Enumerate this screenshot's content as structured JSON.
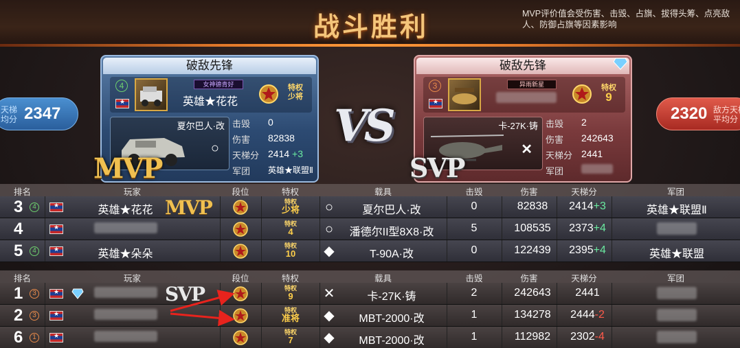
{
  "title": "战斗胜利",
  "mvp_note": "MVP评价值会受伤害、击毁、占旗、拔得头筹、点亮敌人、防御占旗等因素影响",
  "left_ladder": {
    "label": "天梯均分",
    "value": "2347"
  },
  "right_ladder": {
    "label": "敌方天梯平均分",
    "value": "2320"
  },
  "vs_text": "VS",
  "blue_card": {
    "header": "破敌先锋",
    "level": "4",
    "name_plate": "女神德青好",
    "player": "英雄★花花",
    "priv_top": "特权",
    "priv_bottom": "少将",
    "vehicle": "夏尔巴人·改",
    "vehicle_mark": "○",
    "badge": "MVP",
    "stats": {
      "kills_label": "击毁",
      "kills": "0",
      "damage_label": "伤害",
      "damage": "82838",
      "ladder_label": "天梯分",
      "ladder": "2414",
      "ladder_delta": "+3",
      "corps_label": "军团",
      "corps": "英雄★联盟Ⅱ"
    }
  },
  "red_card": {
    "header": "破敌先锋",
    "level": "3",
    "name_plate": "异雨新星",
    "priv_top": "特权",
    "priv_bottom": "9",
    "vehicle": "卡-27K·铸",
    "vehicle_mark": "✕",
    "badge": "SVP",
    "stats": {
      "kills_label": "击毁",
      "kills": "2",
      "damage_label": "伤害",
      "damage": "242643",
      "ladder_label": "天梯分",
      "ladder": "2441",
      "corps_label": "军团"
    }
  },
  "headers": {
    "rank": "排名",
    "player": "玩家",
    "tier": "段位",
    "priv": "特权",
    "vehicle": "载具",
    "kills": "击毁",
    "damage": "伤害",
    "ladder": "天梯分",
    "corps": "军团"
  },
  "blue_rows": [
    {
      "rank": "3",
      "level": "4",
      "name": "英雄★花花",
      "badge": "MVP",
      "priv_top": "特权",
      "priv_bottom": "少将",
      "mode": "○",
      "vehicle": "夏尔巴人·改",
      "kills": "0",
      "damage": "82838",
      "ladder": "2414",
      "delta": "+3",
      "corps": "英雄★联盟Ⅱ"
    },
    {
      "rank": "4",
      "level": "",
      "name": "",
      "badge": "",
      "priv_top": "特权",
      "priv_bottom": "4",
      "mode": "○",
      "vehicle": "潘德尔II型8X8·改",
      "kills": "5",
      "damage": "108535",
      "ladder": "2373",
      "delta": "+4",
      "corps": ""
    },
    {
      "rank": "5",
      "level": "4",
      "name": "英雄★朵朵",
      "badge": "",
      "priv_top": "特权",
      "priv_bottom": "10",
      "mode": "◆",
      "vehicle": "T-90A·改",
      "kills": "0",
      "damage": "122439",
      "ladder": "2395",
      "delta": "+4",
      "corps": "英雄★联盟"
    }
  ],
  "red_rows": [
    {
      "rank": "1",
      "level": "3",
      "name": "",
      "badge": "SVP",
      "priv_top": "特权",
      "priv_bottom": "9",
      "mode": "✕",
      "vehicle": "卡-27K·铸",
      "kills": "2",
      "damage": "242643",
      "ladder": "2441",
      "delta": "",
      "corps": ""
    },
    {
      "rank": "2",
      "level": "3",
      "name": "",
      "badge": "",
      "priv_top": "特权",
      "priv_bottom": "准将",
      "mode": "◆",
      "vehicle": "MBT-2000·改",
      "kills": "1",
      "damage": "134278",
      "ladder": "2444",
      "delta": "-2",
      "corps": ""
    },
    {
      "rank": "6",
      "level": "1",
      "name": "",
      "badge": "",
      "priv_top": "特权",
      "priv_bottom": "7",
      "mode": "◆",
      "vehicle": "MBT-2000·改",
      "kills": "1",
      "damage": "112982",
      "ladder": "2302",
      "delta": "-4",
      "corps": ""
    }
  ],
  "colors": {
    "blue_accent": "#2a5e9c",
    "red_accent": "#a82a22",
    "gold": "#f0c050",
    "positive": "#6aeaa0",
    "negative": "#ff5a4a"
  }
}
